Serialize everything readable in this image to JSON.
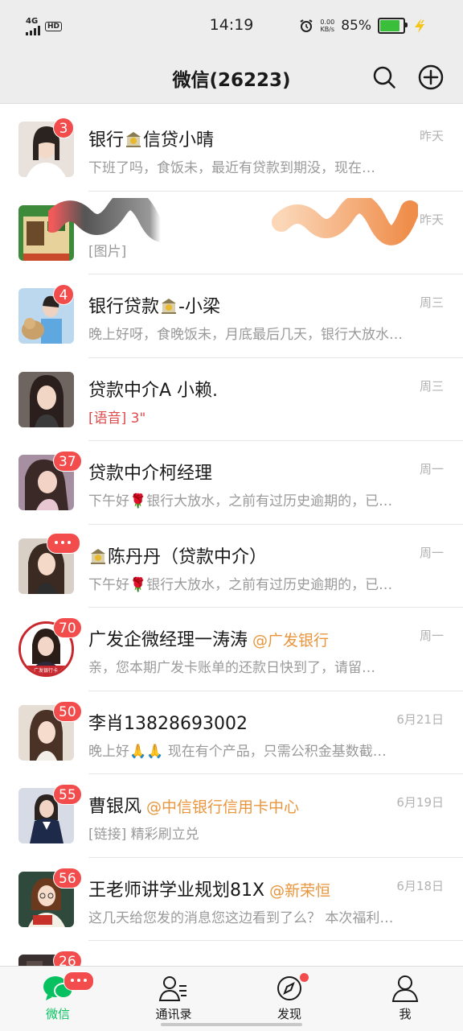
{
  "status_bar": {
    "network": "4G",
    "hd": "HD",
    "time": "14:19",
    "speed_value": "0.00",
    "speed_unit": "KB/s",
    "battery": "85%",
    "battery_level": 0.85
  },
  "nav": {
    "title": "微信(26223)",
    "search_icon": "search-icon",
    "add_icon": "plus-circle-icon"
  },
  "chats": [
    {
      "name_pre": "银行",
      "name_post": "信贷小晴",
      "time": "昨天",
      "badge": "3",
      "preview": "下班了吗，食饭未，最近有贷款到期没，现在…"
    },
    {
      "name": "",
      "time": "昨天",
      "preview": "[图片]"
    },
    {
      "name_pre": "银行贷款",
      "name_post": "-小梁",
      "time": "周三",
      "badge": "4",
      "preview": "晚上好呀，食晚饭未，月底最后几天，银行大放水…"
    },
    {
      "name": "贷款中介A 小赖.",
      "time": "周三",
      "preview_voice": "[语音] 3\""
    },
    {
      "name": "贷款中介柯经理",
      "time": "周一",
      "badge": "37",
      "preview_pre": "下午好",
      "preview_post": "银行大放水，之前有过历史逾期的，已…"
    },
    {
      "name_post": "陈丹丹（贷款中介）",
      "time": "周一",
      "preview_pre": "下午好",
      "preview_post": "银行大放水，之前有过历史逾期的，已…"
    },
    {
      "name": "广发企微经理一涛涛",
      "tag": "@广发银行",
      "time": "周一",
      "badge": "70",
      "preview": "亲，您本期广发卡账单的还款日快到了，请留…",
      "avatar_caption": "广发银行卡"
    },
    {
      "name": "李肖13828693002",
      "time": "6月21日",
      "badge": "50",
      "preview_pre": "晚上好",
      "preview_post": "现在有个产品，只需公积金基数截…"
    },
    {
      "name": "曹银风",
      "tag": "@中信银行信用卡中心",
      "time": "6月19日",
      "badge": "55",
      "preview": "[链接] 精彩刷立兑"
    },
    {
      "name": "王老师讲学业规划81X",
      "tag": "@新荣恒",
      "time": "6月18日",
      "badge": "56",
      "preview": "这几天给您发的消息您这边看到了么？ 本次福利…"
    },
    {
      "name": "",
      "time": "",
      "badge": "26",
      "preview": ""
    }
  ],
  "tabs": [
    {
      "label": "微信",
      "icon": "chat-bubbles-icon"
    },
    {
      "label": "通讯录",
      "icon": "contacts-icon"
    },
    {
      "label": "发现",
      "icon": "compass-icon"
    },
    {
      "label": "我",
      "icon": "person-icon"
    }
  ],
  "colors": {
    "accent": "#07c160",
    "badge": "#f24c4c",
    "tag": "#e8953c",
    "header_bg": "#ededed"
  }
}
